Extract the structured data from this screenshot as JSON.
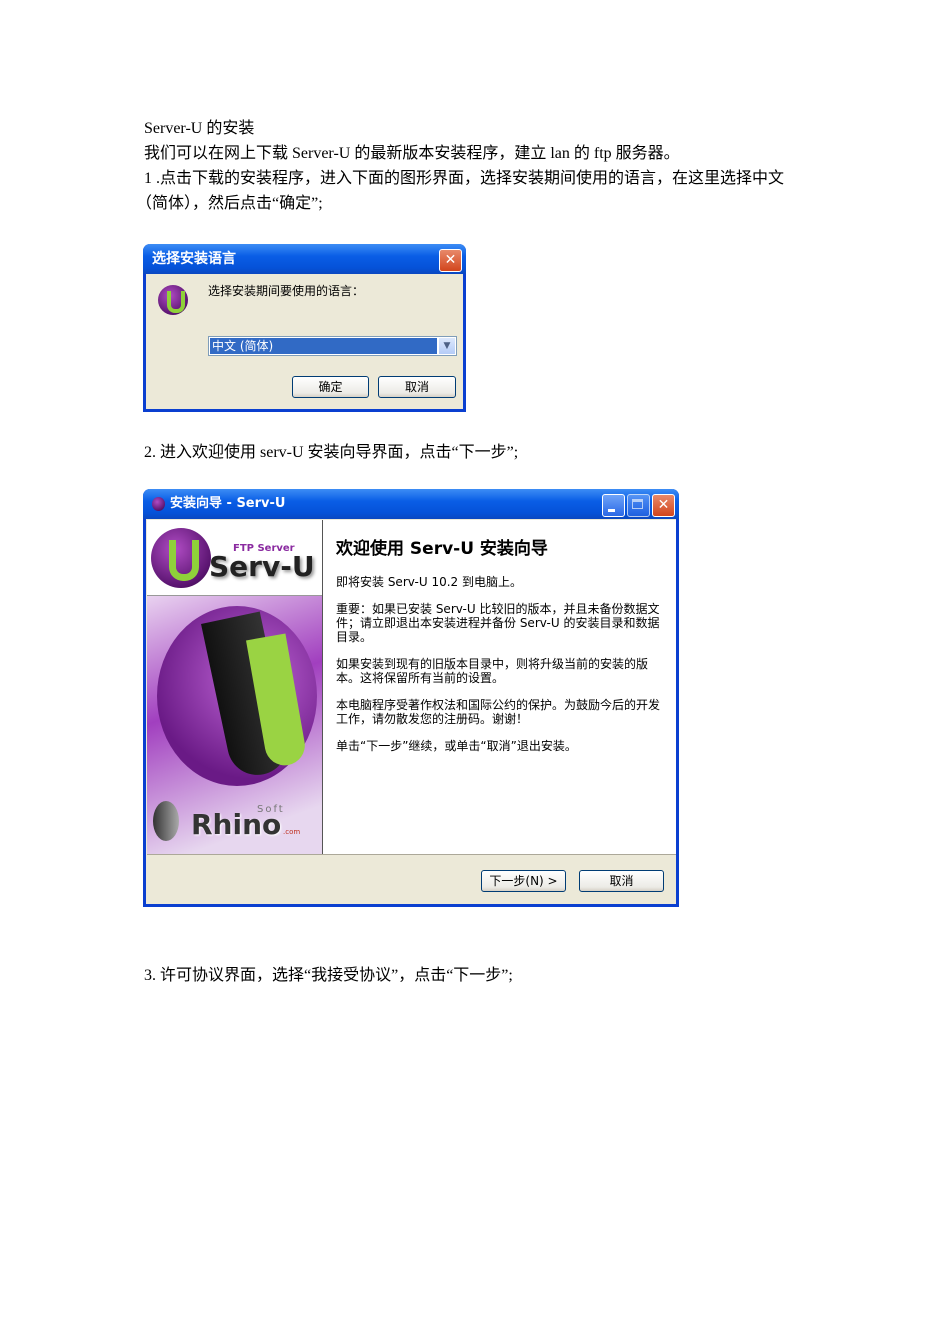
{
  "doc": {
    "title": "Server-U 的安装",
    "intro": "我们可以在网上下载 Server-U 的最新版本安装程序，建立 lan 的 ftp 服务器。",
    "step1_line1": "1 .点击下载的安装程序，进入下面的图形界面，选择安装期间使用的语言，在这里选择中文",
    "step1_line2": "（简体），然后点击“确定”;",
    "step2": "2.  进入欢迎使用 serv-U 安装向导界面，点击“下一步”;",
    "step3": "3.  许可协议界面，选择“我接受协议”，点击“下一步”;"
  },
  "lang_dialog": {
    "title": "选择安装语言",
    "prompt": "选择安装期间要使用的语言：",
    "selected_language": "中文 (简体)",
    "ok": "确定",
    "cancel": "取消"
  },
  "wizard": {
    "title": "安装向导 - Serv-U",
    "logo_small": "FTP Server",
    "logo_big": "Serv-U",
    "brand": "Rhino",
    "brand_soft": "Soft",
    "brand_com": ".com",
    "heading": "欢迎使用 Serv-U 安装向导",
    "paragraphs": [
      "即将安装 Serv-U 10.2 到电脑上。",
      "重要：如果已安装 Serv-U 比较旧的版本，并且未备份数据文件；请立即退出本安装进程并备份 Serv-U 的安装目录和数据目录。",
      "如果安装到现有的旧版本目录中，则将升级当前的安装的版本。这将保留所有当前的设置。",
      "本电脑程序受著作权法和国际公约的保护。为鼓励今后的开发工作，请勿散发您的注册码。谢谢！",
      "单击“下一步”继续，或单击“取消”退出安装。"
    ],
    "next": "下一步(N) >",
    "cancel": "取消"
  }
}
